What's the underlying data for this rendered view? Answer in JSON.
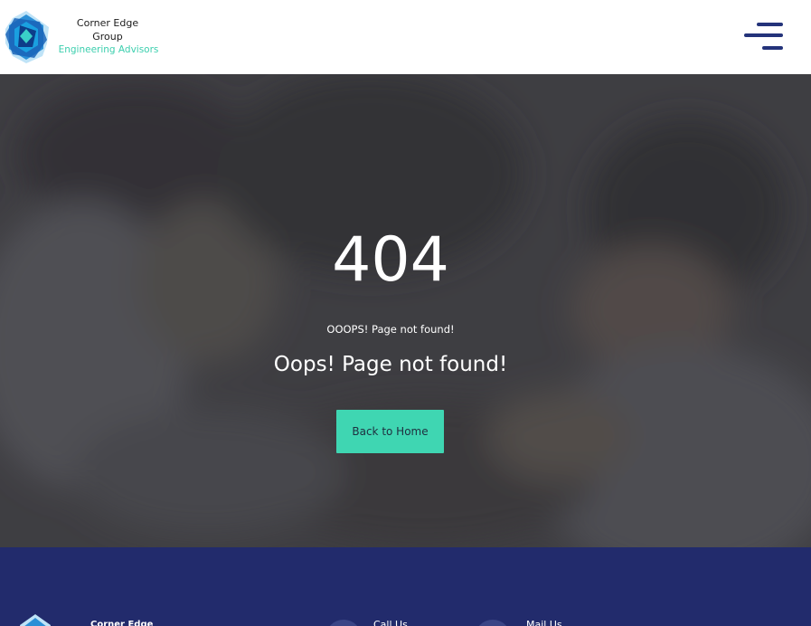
{
  "header": {
    "brand_name": "Corner Edge Group",
    "brand_tagline": "Engineering Advisors",
    "logo_icon": "star-polygon-logo-icon",
    "menu_icon": "hamburger-menu-icon"
  },
  "hero": {
    "error_code": "404",
    "subtitle": "OOOPS! Page not found!",
    "title": "Oops! Page not found!",
    "button_label": "Back to Home",
    "overlay_color": "#3f3f44"
  },
  "footer": {
    "brand_name": "Corner Edge",
    "call_label": "Call Us",
    "mail_label": "Mail Us",
    "background_color": "#222b6c"
  },
  "colors": {
    "accent": "#3fd6b2",
    "brand_navy": "#24337a",
    "logo_blue": "#1f7fc9"
  }
}
